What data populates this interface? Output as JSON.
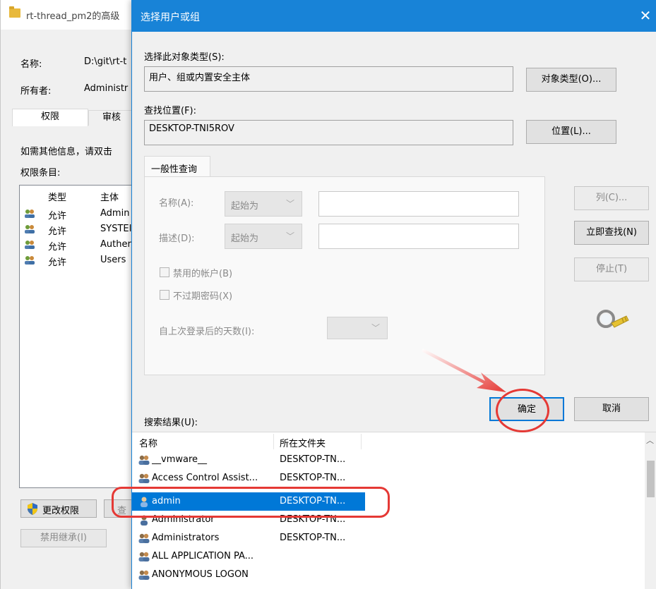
{
  "background_window": {
    "title": "rt-thread_pm2的高级",
    "name_label": "名称:",
    "name_value": "D:\\git\\rt-t",
    "owner_label": "所有者:",
    "owner_value": "Administr",
    "tabs": [
      "权限",
      "审核"
    ],
    "hint": "如需其他信息，请双击",
    "entries_label": "权限条目:",
    "list_headers": [
      "类型",
      "主体"
    ],
    "rows": [
      {
        "type": "允许",
        "principal": "Admin"
      },
      {
        "type": "允许",
        "principal": "SYSTEI"
      },
      {
        "type": "允许",
        "principal": "Auther"
      },
      {
        "type": "允许",
        "principal": "Users"
      }
    ],
    "change_button": "更改权限",
    "view_button": "查",
    "disable_button": "禁用继承(I)"
  },
  "dialog": {
    "title": "选择用户或组",
    "object_type_label": "选择此对象类型(S):",
    "object_type_value": "用户、组或内置安全主体",
    "object_type_button": "对象类型(O)...",
    "location_label": "查找位置(F):",
    "location_value": "DESKTOP-TNI5ROV",
    "location_button": "位置(L)...",
    "group_tab": "一般性查询",
    "name_label": "名称(A):",
    "name_select": "起始为",
    "desc_label": "描述(D):",
    "desc_select": "起始为",
    "disabled_accounts": "禁用的帐户(B)",
    "no_expire": "不过期密码(X)",
    "days_label": "自上次登录后的天数(I):",
    "columns_button": "列(C)...",
    "find_now_button": "立即查找(N)",
    "stop_button": "停止(T)",
    "ok_button": "确定",
    "cancel_button": "取消",
    "results_label": "搜索结果(U):",
    "results_headers": [
      "名称",
      "所在文件夹"
    ],
    "results": [
      {
        "name": "__vmware__",
        "folder": "DESKTOP-TN...",
        "icon": "group-icon"
      },
      {
        "name": "Access Control Assist...",
        "folder": "DESKTOP-TN...",
        "icon": "group-icon"
      },
      {
        "name": "admin",
        "folder": "DESKTOP-TN...",
        "icon": "user-icon",
        "selected": true
      },
      {
        "name": "Administrator",
        "folder": "DESKTOP-TN...",
        "icon": "user-icon"
      },
      {
        "name": "Administrators",
        "folder": "DESKTOP-TN...",
        "icon": "group-icon"
      },
      {
        "name": "ALL APPLICATION PA...",
        "folder": "",
        "icon": "group-icon"
      },
      {
        "name": "ANONYMOUS LOGON",
        "folder": "",
        "icon": "group-icon"
      }
    ]
  },
  "colors": {
    "titlebar_blue": "#1883d7",
    "selection_blue": "#0078d7",
    "annotation_red": "#e53935"
  }
}
